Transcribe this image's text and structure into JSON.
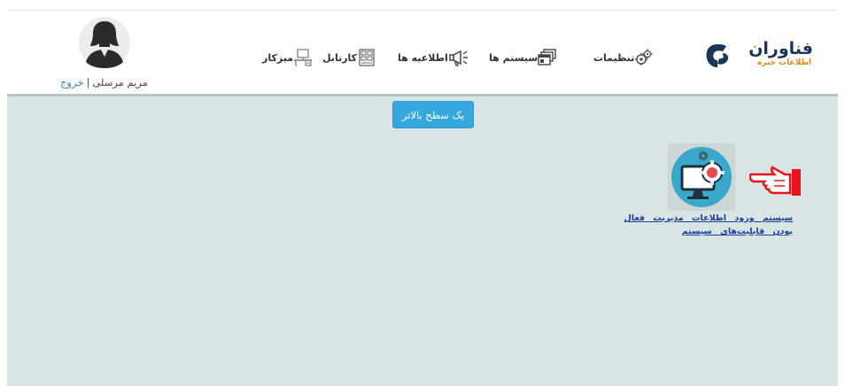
{
  "brand": {
    "name": "فناوران",
    "tagline": "اطلاعات خبره",
    "colors": {
      "navy": "#1a3556",
      "orange": "#e08a1e"
    }
  },
  "nav": [
    {
      "label": "تنظیمات",
      "icon": "gears-icon"
    },
    {
      "label": "سیستم ها",
      "icon": "windows-icon"
    },
    {
      "label": "اطلاعیه ها",
      "icon": "megaphone-icon"
    },
    {
      "label": "کارتابل",
      "icon": "cartable-icon"
    },
    {
      "label": "میزکار",
      "icon": "desk-icon"
    }
  ],
  "user": {
    "name": "مریم مرسلی",
    "separator": "|",
    "logout_label": "خروج"
  },
  "main": {
    "up_button_label": "یک سطح بالاتر",
    "system_link_label": "سیستم ورود اطلاعات مدیریت فعال بودن قابلیت‌های سیستم",
    "background": "#d9e5e5"
  }
}
